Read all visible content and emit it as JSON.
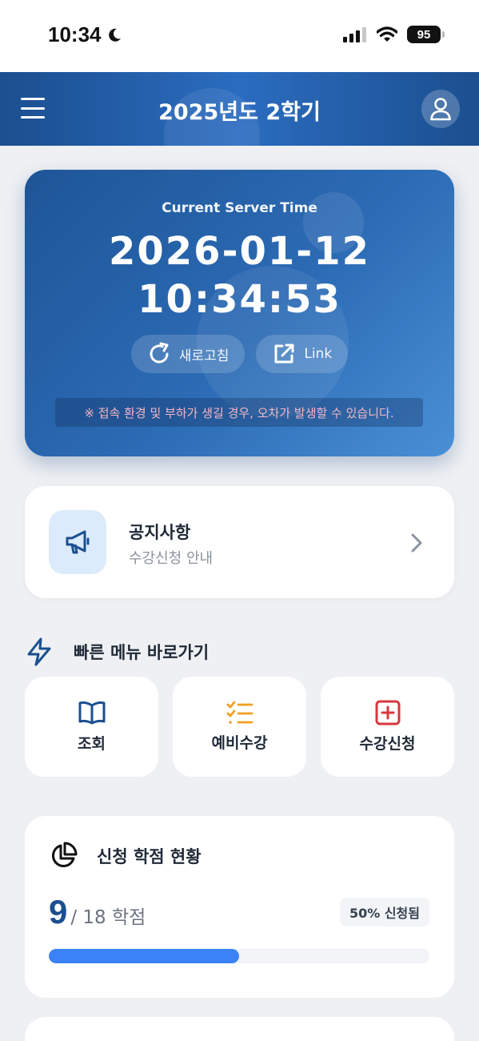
{
  "status_bar": {
    "time": "10:34",
    "battery": "95"
  },
  "header": {
    "title": "2025년도 2학기"
  },
  "server_time": {
    "caption": "Current Server Time",
    "date": "2026-01-12",
    "clock": "10:34:53",
    "refresh_label": "새로고침",
    "link_label": "Link",
    "notice": "※ 접속 환경 및 부하가 생길 경우, 오차가 발생할 수 있습니다."
  },
  "notice_card": {
    "title": "공지사항",
    "subtitle": "수강신청 안내"
  },
  "quick_menu": {
    "title": "빠른 메뉴 바로가기",
    "items": [
      {
        "label": "조회",
        "icon": "book-icon"
      },
      {
        "label": "예비수강",
        "icon": "checklist-icon"
      },
      {
        "label": "수강신청",
        "icon": "plus-square-icon"
      }
    ]
  },
  "credits": {
    "title": "신청 학점 현황",
    "current": "9",
    "total": "/ 18 학점",
    "badge": "50% 신청됨",
    "progress": 0.5
  },
  "colors": {
    "primary": "#1b4f8f",
    "accent_blue": "#3b82f6",
    "checklist_orange": "#f0a020",
    "plus_red": "#d9363e",
    "notice_pink": "#f4b6c4"
  }
}
